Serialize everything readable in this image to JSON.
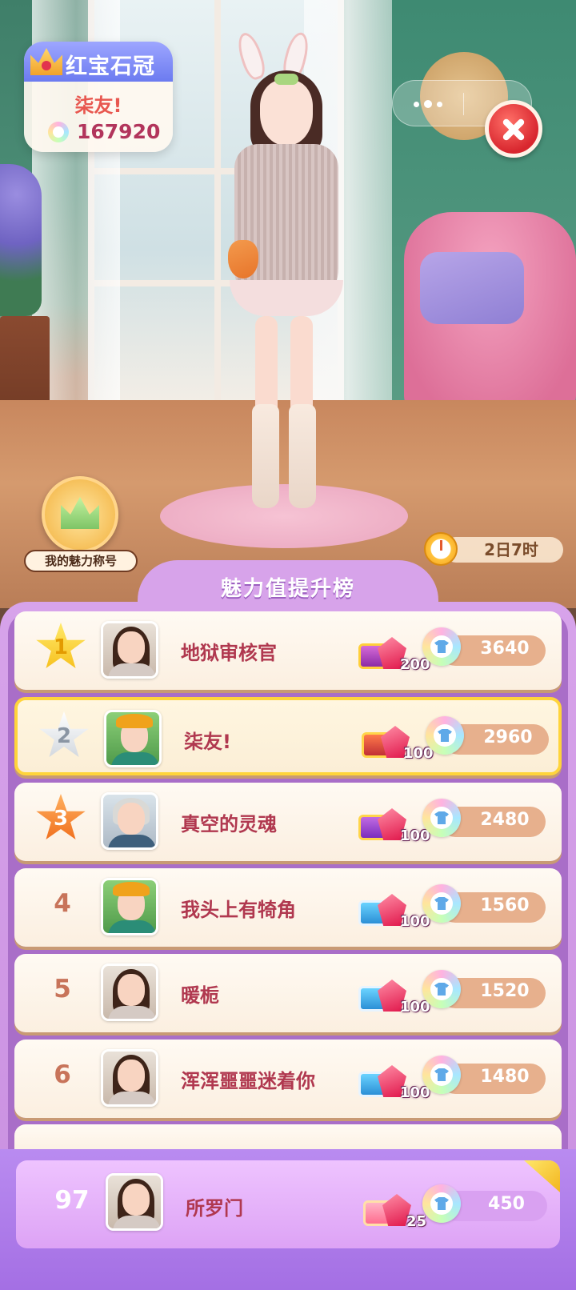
{
  "title_card": {
    "title": "红宝石冠",
    "player_name": "柒友!",
    "charm_score": "167920"
  },
  "my_title": {
    "label": "我的魅力称号"
  },
  "timer": {
    "remaining": "2日7时"
  },
  "board": {
    "title": "魅力值提升榜",
    "rows": [
      {
        "rank": "1",
        "name": "地狱审核官",
        "reward_qty": "200",
        "charm": "3640"
      },
      {
        "rank": "2",
        "name": "柒友!",
        "reward_qty": "100",
        "charm": "2960"
      },
      {
        "rank": "3",
        "name": "真空的灵魂",
        "reward_qty": "100",
        "charm": "2480"
      },
      {
        "rank": "4",
        "name": "我头上有犄角",
        "reward_qty": "100",
        "charm": "1560"
      },
      {
        "rank": "5",
        "name": "暖栀",
        "reward_qty": "100",
        "charm": "1520"
      },
      {
        "rank": "6",
        "name": "浑浑噩噩迷着你",
        "reward_qty": "100",
        "charm": "1480"
      }
    ]
  },
  "my_rank": {
    "rank": "97",
    "name": "所罗门",
    "reward_qty": "25",
    "charm": "450"
  },
  "colors": {
    "accent_purple": "#c98fe0",
    "name_red": "#b0384f",
    "highlight_gold": "#ffd43b"
  }
}
